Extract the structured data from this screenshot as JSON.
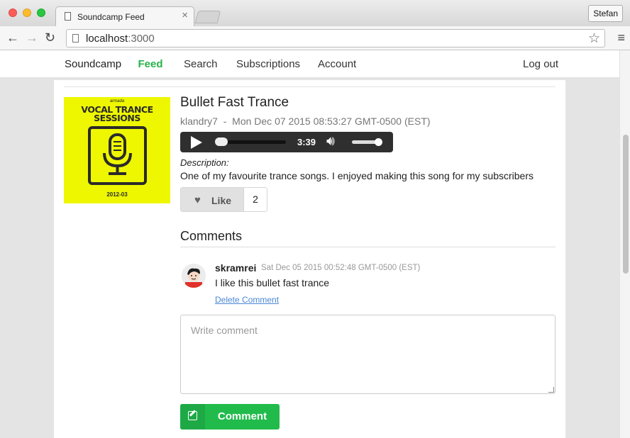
{
  "browser": {
    "tab_title": "Soundcamp Feed",
    "tab_close": "×",
    "profile_name": "Stefan",
    "url_host": "localhost",
    "url_port": ":3000"
  },
  "nav": {
    "brand": "Soundcamp",
    "links": {
      "feed": "Feed",
      "search": "Search",
      "subscriptions": "Subscriptions",
      "account": "Account",
      "logout": "Log out"
    },
    "active": "Feed",
    "accent_color": "#26b24b"
  },
  "song": {
    "cover": {
      "brand": "armada",
      "title_line1": "VOCAL TRANCE",
      "title_line2": "SESSIONS",
      "date": "2012-03",
      "background": "#eef700"
    },
    "title": "Bullet Fast Trance",
    "author": "klandry7",
    "separator": "-",
    "uploaded": "Mon Dec 07 2015 08:53:27 GMT-0500 (EST)",
    "player": {
      "time": "3:39",
      "progress": 0.0,
      "volume": 0.9
    },
    "description_label": "Description:",
    "description": "One of my favourite trance songs. I enjoyed making this song for my subscribers",
    "like_label": "Like",
    "like_count": "2"
  },
  "comments": {
    "title": "Comments",
    "items": [
      {
        "author": "skramrei",
        "timestamp": "Sat Dec 05 2015 00:52:48 GMT-0500 (EST)",
        "body": "I like this bullet fast trance",
        "delete_label": "Delete Comment"
      }
    ],
    "input_placeholder": "Write comment",
    "submit_label": "Comment",
    "submit_color": "#21bb4c"
  }
}
